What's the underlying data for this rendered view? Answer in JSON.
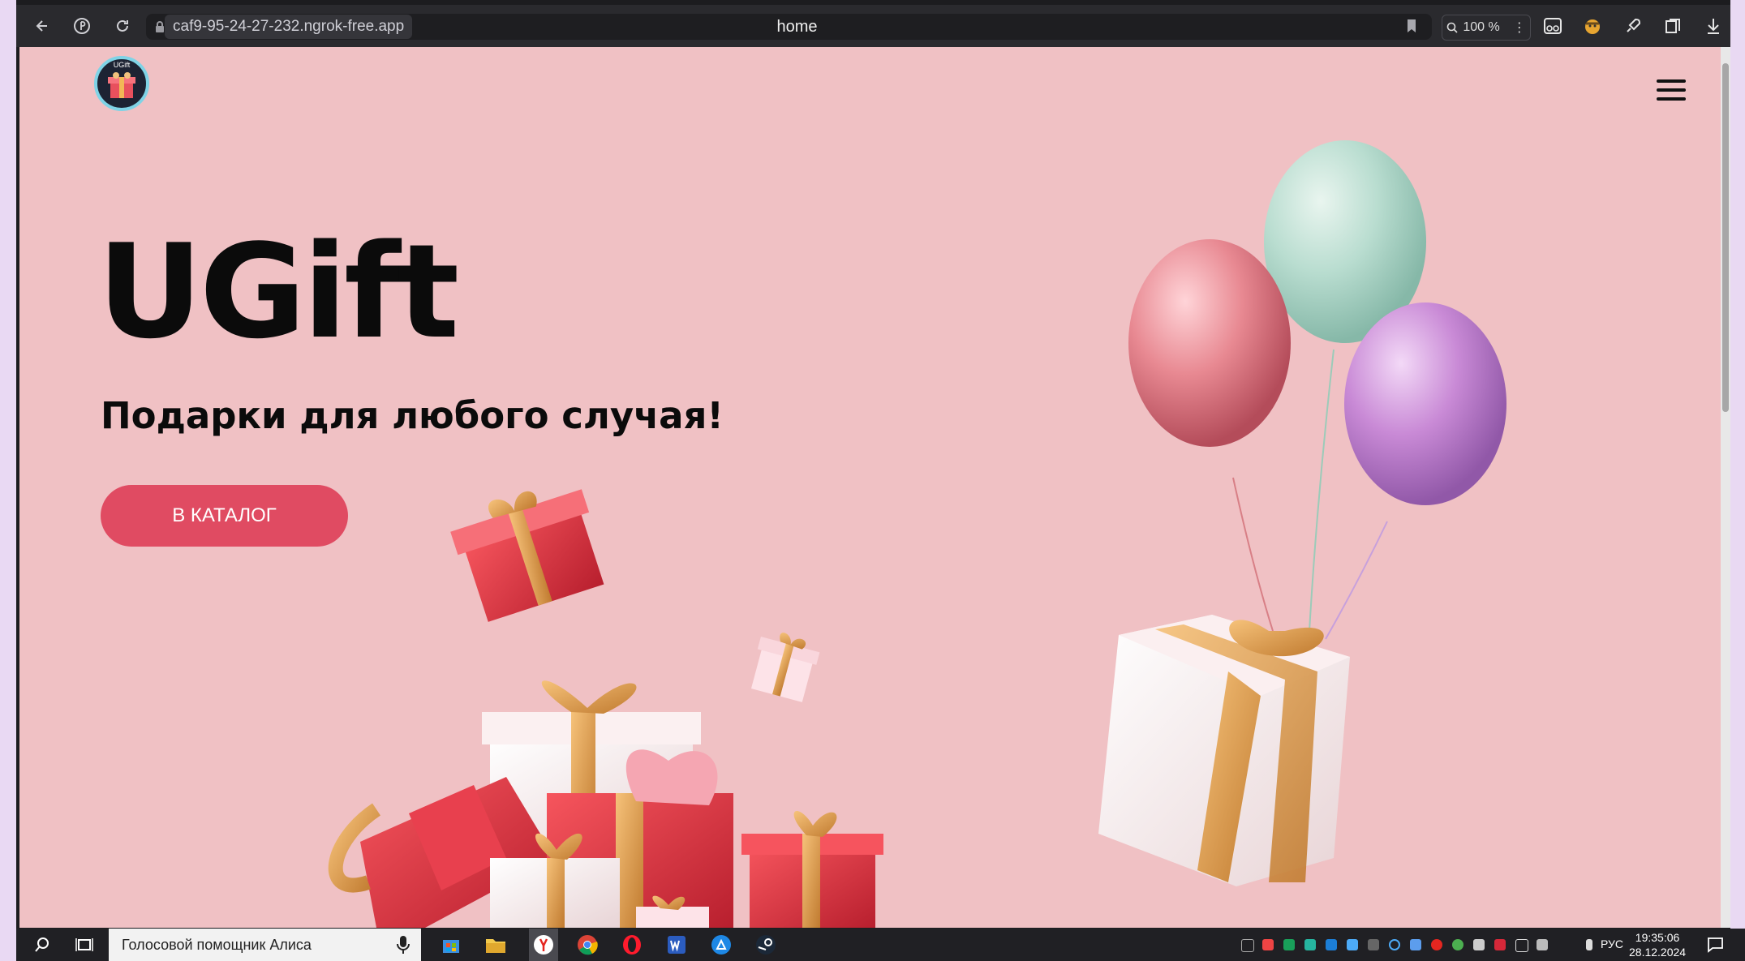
{
  "browser": {
    "url": "caf9-95-24-27-232.ngrok-free.app",
    "tab_title": "home",
    "zoom": "100 %",
    "buttons": [
      "back-icon",
      "yandex-icon",
      "reload-icon",
      "lock-icon",
      "bookmark-icon",
      "zoom-icon",
      "more-icon",
      "reader-icon",
      "extension-icon",
      "rocket-icon",
      "collections-icon",
      "download-icon"
    ]
  },
  "page": {
    "logo_text": "UGift",
    "hero_title": "UGift",
    "hero_subtitle": "Подарки для любого случая!",
    "catalog_button": "В КАТАЛОГ",
    "menu_icon": "hamburger-icon",
    "colors": {
      "background": "#f0c1c4",
      "button": "#e04b62",
      "text": "#0b0b0b"
    }
  },
  "taskbar": {
    "search_placeholder": "Голосовой помощник Алиса",
    "language": "РУС",
    "time": "19:35:06",
    "date": "28.12.2024",
    "apps": [
      "store-icon",
      "explorer-icon",
      "yandex-browser-icon",
      "chrome-icon",
      "opera-icon",
      "word-icon",
      "app-icon",
      "steam-icon"
    ]
  }
}
